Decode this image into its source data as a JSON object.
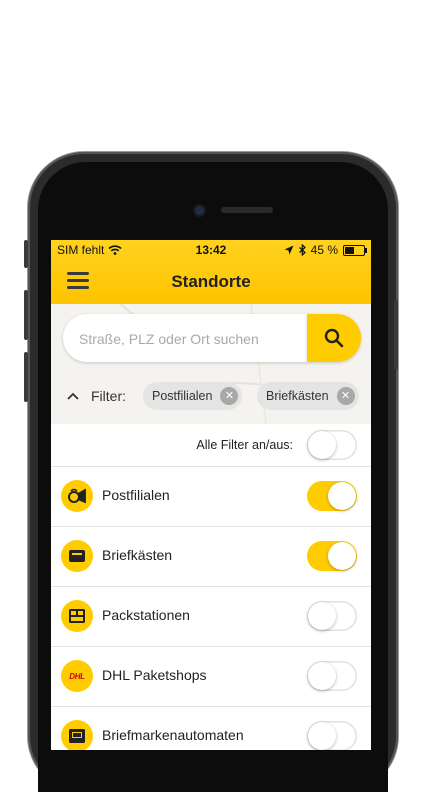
{
  "status_bar": {
    "carrier": "SIM fehlt",
    "time": "13:42",
    "battery_text": "45 %",
    "battery_level": 0.45
  },
  "nav": {
    "title": "Standorte"
  },
  "search": {
    "placeholder": "Straße, PLZ oder Ort suchen",
    "value": ""
  },
  "filter": {
    "label": "Filter:",
    "chips": [
      "Postfilialen",
      "Briefkästen"
    ]
  },
  "all_filters": {
    "label": "Alle Filter an/aus:",
    "on": false
  },
  "items": [
    {
      "label": "Postfilialen",
      "icon": "posthorn-icon",
      "on": true
    },
    {
      "label": "Briefkästen",
      "icon": "mailbox-icon",
      "on": true
    },
    {
      "label": "Packstationen",
      "icon": "packstation-icon",
      "on": false
    },
    {
      "label": "DHL Paketshops",
      "icon": "dhl-logo-icon",
      "icon_text": "DHL",
      "on": false
    },
    {
      "label": "Briefmarkenautomaten",
      "icon": "stamp-machine-icon",
      "on": false
    }
  ],
  "colors": {
    "brand_yellow": "#ffcc00",
    "dhl_red": "#d40511"
  }
}
